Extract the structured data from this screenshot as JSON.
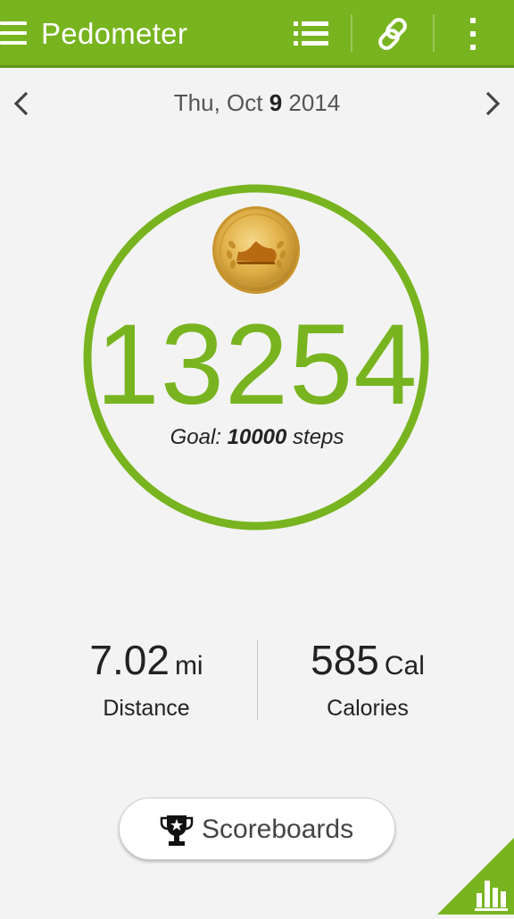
{
  "app": {
    "title": "Pedometer"
  },
  "toolbar": {
    "list_icon": "list-icon",
    "link_icon": "link-icon",
    "overflow_icon": "more-vert-icon"
  },
  "date": {
    "prefix": "Thu, Oct ",
    "day": "9",
    "year": " 2014"
  },
  "steps": {
    "count": "13254",
    "goal_prefix": "Goal: ",
    "goal_value": "10000",
    "goal_suffix": " steps",
    "goal_progress": 1.3254
  },
  "stats": {
    "distance": {
      "value": "7.02",
      "unit": "mi",
      "label": "Distance"
    },
    "calories": {
      "value": "585",
      "unit": "Cal",
      "label": "Calories"
    }
  },
  "scoreboards": {
    "label": "Scoreboards"
  },
  "colors": {
    "accent": "#78b41f",
    "appbar": "#78b41f",
    "background": "#f3f3f3",
    "medal": "#d9a93a"
  }
}
